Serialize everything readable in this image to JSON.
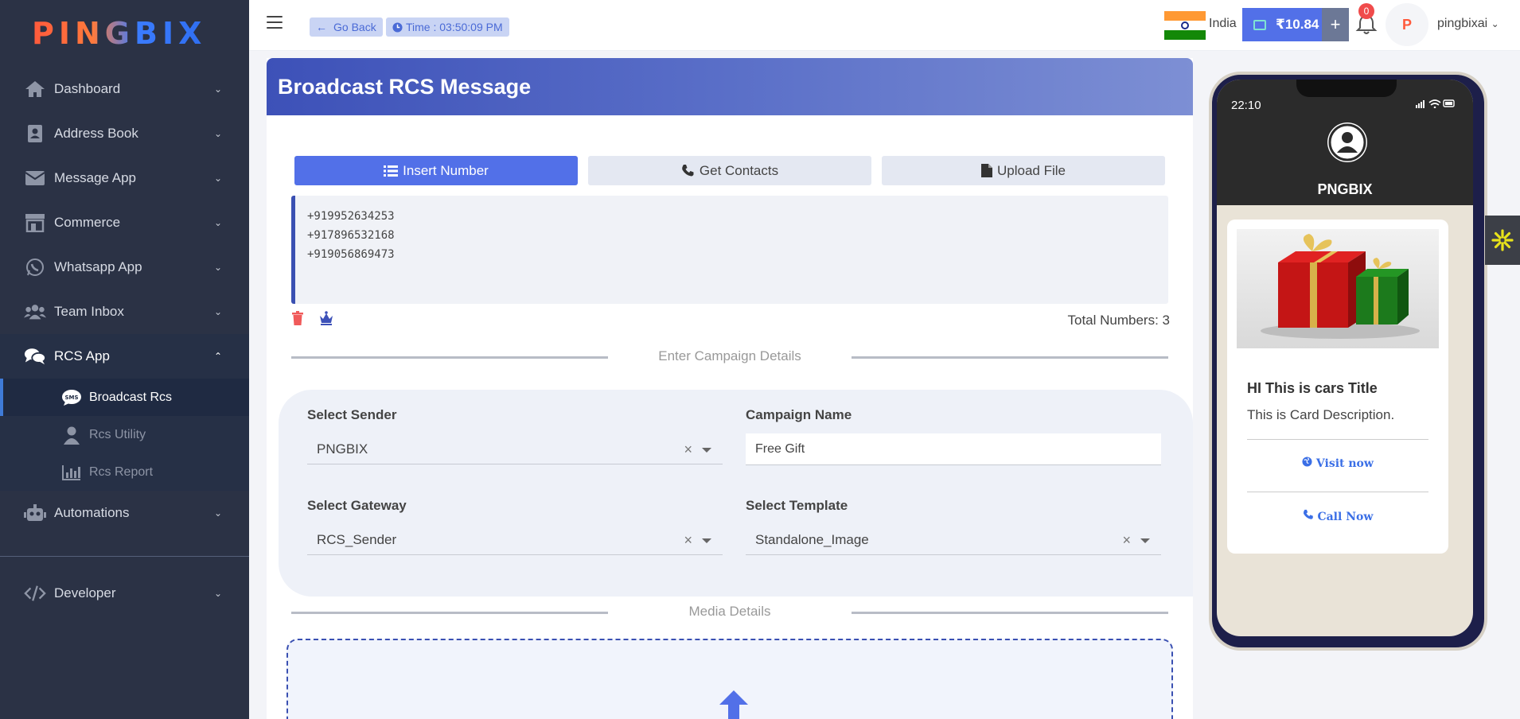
{
  "brand": {
    "logo_text": "PINGBIX"
  },
  "sidebar": {
    "items": [
      {
        "label": "Dashboard"
      },
      {
        "label": "Address Book"
      },
      {
        "label": "Message App"
      },
      {
        "label": "Commerce"
      },
      {
        "label": "Whatsapp App"
      },
      {
        "label": "Team Inbox"
      },
      {
        "label": "RCS App"
      },
      {
        "label": "Automations"
      },
      {
        "label": "Developer"
      }
    ],
    "rcs_sub": [
      {
        "label": "Broadcast Rcs"
      },
      {
        "label": "Rcs Utility"
      },
      {
        "label": "Rcs Report"
      }
    ]
  },
  "topbar": {
    "go_back": "Go Back",
    "time": "Time : 03:50:09 PM",
    "country": "India",
    "balance": "₹10.84",
    "add": "+",
    "notifications": "0",
    "username": "pingbixai",
    "avatar_letter": "P"
  },
  "page": {
    "title": "Broadcast RCS Message",
    "tabs": [
      "Insert Number",
      "Get Contacts",
      "Upload File"
    ],
    "numbers": [
      "+919952634253",
      "+917896532168",
      "+919056869473"
    ],
    "total_label": "Total Numbers: 3",
    "section_campaign": "Enter Campaign Details",
    "section_media": "Media Details",
    "form": {
      "sender_label": "Select Sender",
      "sender_value": "PNGBIX",
      "campaign_label": "Campaign Name",
      "campaign_value": "Free Gift",
      "gateway_label": "Select Gateway",
      "gateway_value": "RCS_Sender",
      "template_label": "Select Template",
      "template_value": "Standalone_Image",
      "clear": "×"
    }
  },
  "preview": {
    "status_time": "22:10",
    "sender_name": "PNGBIX",
    "card_title": "HI This is cars Title",
    "card_desc": "This is Card Description.",
    "btn_visit": "Visit now",
    "btn_call": "Call Now"
  },
  "colors": {
    "primary": "#5270e8",
    "sidebar": "#2b3245",
    "header_start": "#3d51b8"
  }
}
